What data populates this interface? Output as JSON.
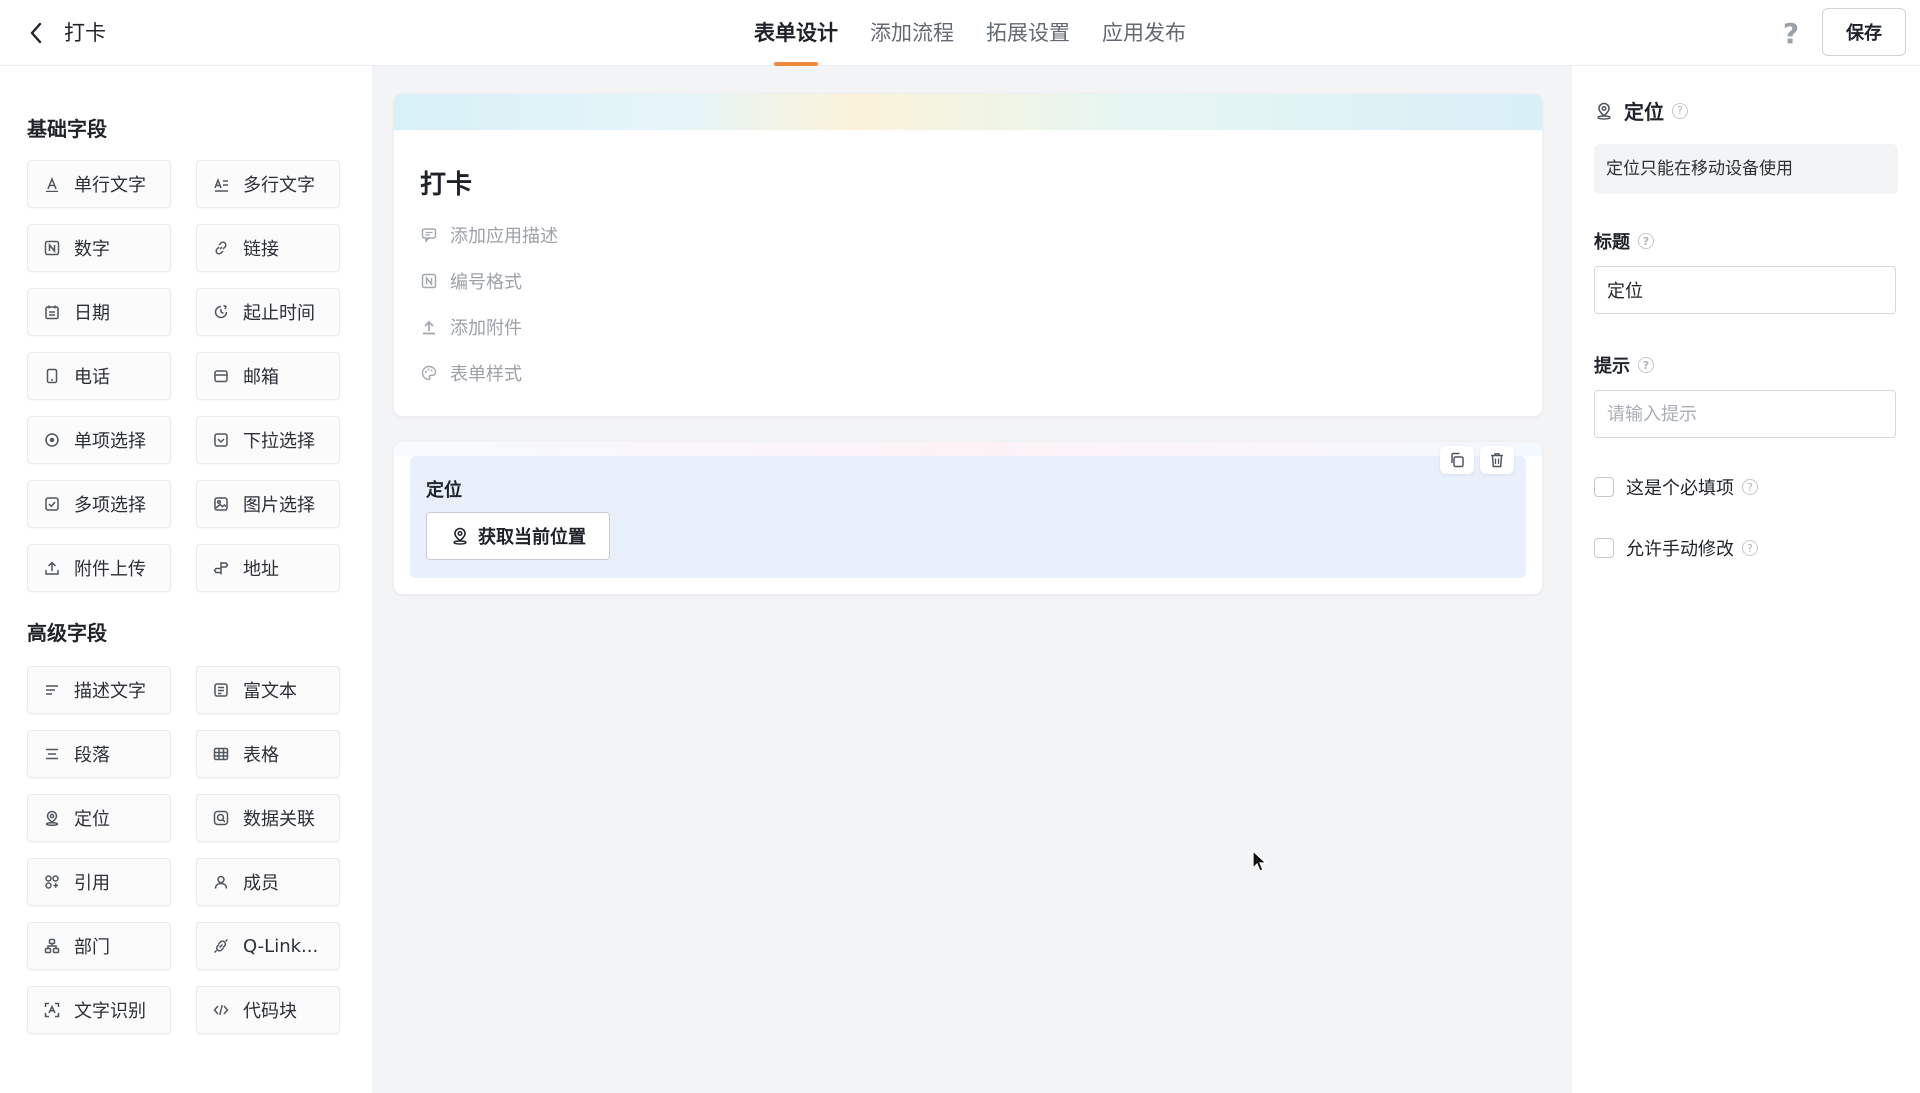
{
  "header": {
    "title": "打卡",
    "tabs": [
      {
        "label": "表单设计",
        "active": true
      },
      {
        "label": "添加流程",
        "active": false
      },
      {
        "label": "拓展设置",
        "active": false
      },
      {
        "label": "应用发布",
        "active": false
      }
    ],
    "help": "?",
    "save_label": "保存"
  },
  "palette": {
    "basic_title": "基础字段",
    "basic": [
      {
        "label": "单行文字",
        "icon": "single-line-text-icon"
      },
      {
        "label": "多行文字",
        "icon": "multi-line-text-icon"
      },
      {
        "label": "数字",
        "icon": "number-icon"
      },
      {
        "label": "链接",
        "icon": "link-icon"
      },
      {
        "label": "日期",
        "icon": "calendar-icon"
      },
      {
        "label": "起止时间",
        "icon": "time-range-icon"
      },
      {
        "label": "电话",
        "icon": "phone-icon"
      },
      {
        "label": "邮箱",
        "icon": "mail-icon"
      },
      {
        "label": "单项选择",
        "icon": "radio-icon"
      },
      {
        "label": "下拉选择",
        "icon": "dropdown-icon"
      },
      {
        "label": "多项选择",
        "icon": "checkbox-icon"
      },
      {
        "label": "图片选择",
        "icon": "image-icon"
      },
      {
        "label": "附件上传",
        "icon": "upload-icon"
      },
      {
        "label": "地址",
        "icon": "address-icon"
      }
    ],
    "advanced_title": "高级字段",
    "advanced": [
      {
        "label": "描述文字",
        "icon": "description-icon"
      },
      {
        "label": "富文本",
        "icon": "rich-text-icon"
      },
      {
        "label": "段落",
        "icon": "paragraph-icon"
      },
      {
        "label": "表格",
        "icon": "table-icon"
      },
      {
        "label": "定位",
        "icon": "location-icon"
      },
      {
        "label": "数据关联",
        "icon": "data-link-icon"
      },
      {
        "label": "引用",
        "icon": "reference-icon"
      },
      {
        "label": "成员",
        "icon": "member-icon"
      },
      {
        "label": "部门",
        "icon": "department-icon"
      },
      {
        "label": "Q-Link...",
        "icon": "q-link-icon"
      },
      {
        "label": "文字识别",
        "icon": "ocr-icon"
      },
      {
        "label": "代码块",
        "icon": "code-icon"
      }
    ]
  },
  "form": {
    "title": "打卡",
    "meta": [
      {
        "label": "添加应用描述",
        "icon": "comment-icon"
      },
      {
        "label": "编号格式",
        "icon": "number-format-icon"
      },
      {
        "label": "添加附件",
        "icon": "attachment-upload-icon"
      },
      {
        "label": "表单样式",
        "icon": "palette-icon"
      }
    ],
    "field": {
      "label": "定位",
      "button_label": "获取当前位置"
    }
  },
  "props": {
    "title": "定位",
    "notice": "定位只能在移动设备使用",
    "title_label": "标题",
    "title_value": "定位",
    "hint_label": "提示",
    "hint_placeholder": "请输入提示",
    "required_label": "这是个必填项",
    "manual_edit_label": "允许手动修改"
  }
}
